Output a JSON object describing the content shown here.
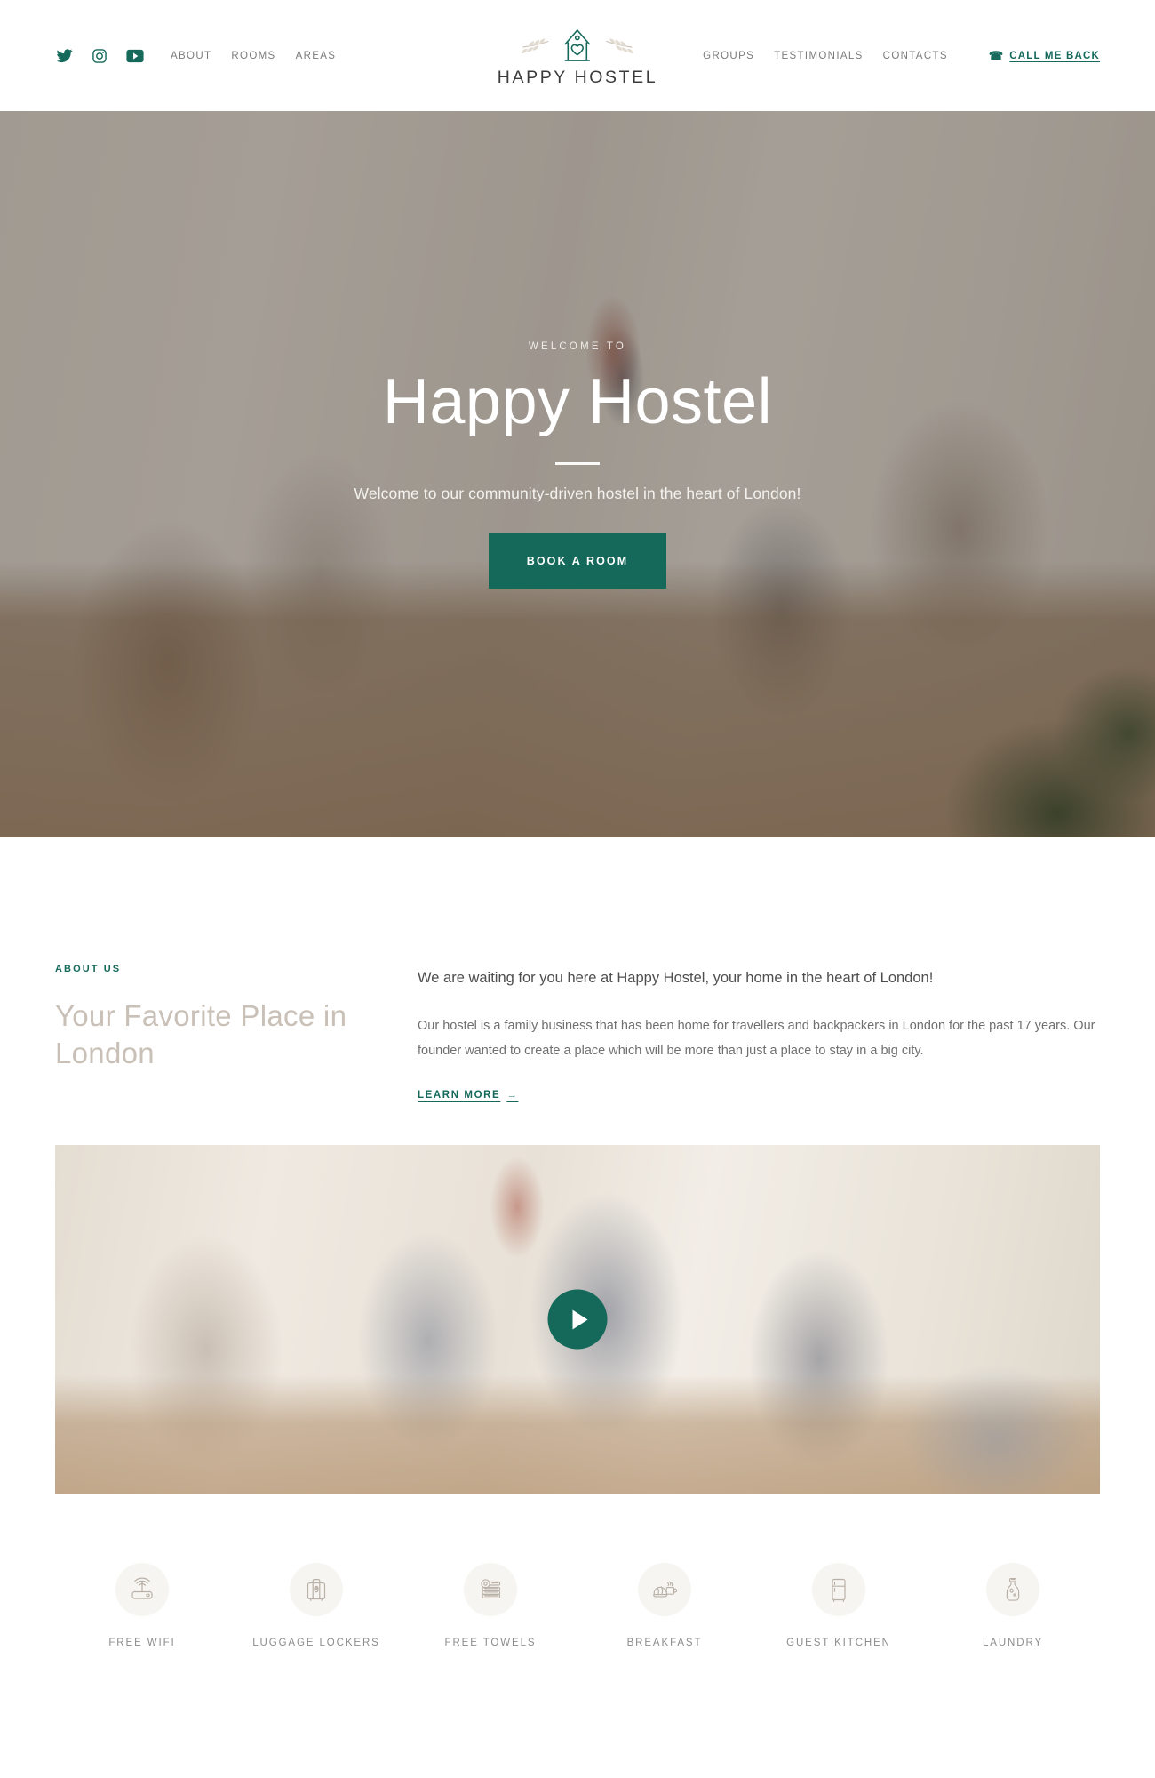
{
  "brand": {
    "name": "HAPPY HOSTEL",
    "logo_icon": "house-heart-logo-icon",
    "accent_color": "#14695b",
    "muted_heading_color": "#c9c0b7"
  },
  "header": {
    "social": [
      {
        "icon": "twitter-icon",
        "name": "Twitter"
      },
      {
        "icon": "instagram-icon",
        "name": "Instagram"
      },
      {
        "icon": "youtube-icon",
        "name": "YouTube"
      }
    ],
    "nav_left": [
      {
        "label": "ABOUT"
      },
      {
        "label": "ROOMS"
      },
      {
        "label": "AREAS"
      }
    ],
    "nav_right": [
      {
        "label": "GROUPS"
      },
      {
        "label": "TESTIMONIALS"
      },
      {
        "label": "CONTACTS"
      }
    ],
    "callback": {
      "label": "CALL ME BACK",
      "icon": "telephone-icon",
      "glyph": "☎"
    }
  },
  "hero": {
    "eyebrow": "WELCOME TO",
    "title": "Happy Hostel",
    "subtitle": "Welcome to our community-driven hostel in the heart of London!",
    "cta_label": "BOOK A ROOM"
  },
  "about": {
    "eyebrow": "ABOUT US",
    "heading": "Your Favorite Place in London",
    "lead": "We are waiting for you here at Happy Hostel, your home in the heart of London!",
    "body": "Our hostel is a family business that has been home for travellers and backpackers in London for the past 17 years. Our founder wanted to create a place which will be more than just a place to stay in a big city.",
    "link_label": "LEARN MORE",
    "link_arrow": "→"
  },
  "video": {
    "play_icon": "play-icon"
  },
  "amenities": [
    {
      "label": "FREE WIFI",
      "icon": "wifi-router-icon"
    },
    {
      "label": "LUGGAGE LOCKERS",
      "icon": "suitcase-icon"
    },
    {
      "label": "FREE TOWELS",
      "icon": "towel-stack-icon"
    },
    {
      "label": "BREAKFAST",
      "icon": "croissant-coffee-icon"
    },
    {
      "label": "GUEST KITCHEN",
      "icon": "refrigerator-icon"
    },
    {
      "label": "LAUNDRY",
      "icon": "detergent-bottle-icon"
    }
  ]
}
